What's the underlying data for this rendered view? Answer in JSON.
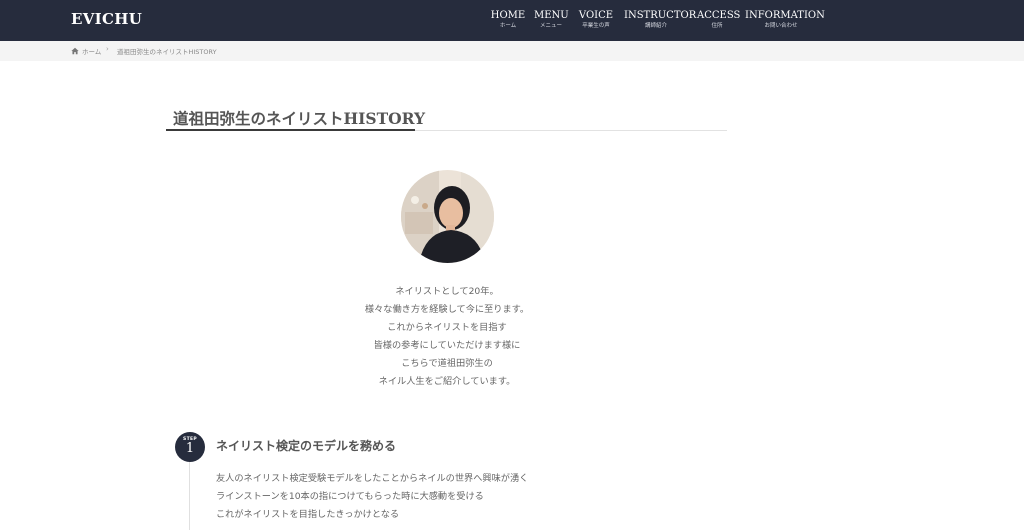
{
  "header": {
    "logo": "EVICHU",
    "nav": [
      {
        "label": "HOME",
        "sub": "ホーム"
      },
      {
        "label": "MENU",
        "sub": "メニュー"
      },
      {
        "label": "VOICE",
        "sub": "卒業生の声"
      },
      {
        "label": "INSTRUCTOR",
        "sub": "講師紹介"
      },
      {
        "label": "ACCESS",
        "sub": "住所"
      },
      {
        "label": "INFORMATION",
        "sub": "お問い合わせ"
      }
    ],
    "colors": {
      "background": "#262c3d",
      "text": "#ffffff"
    }
  },
  "breadcrumb": {
    "home_icon": "home-icon",
    "home": "ホーム",
    "separator": "›",
    "current": "道祖田弥生のネイリストHISTORY"
  },
  "page": {
    "title": "道祖田弥生のネイリストHISTORY",
    "intro_lines": [
      "ネイリストとして20年。",
      "様々な働き方を経験して今に至ります。",
      "これからネイリストを目指す",
      "皆様の参考にしていただけます様に",
      "こちらで道祖田弥生の",
      "ネイル人生をご紹介しています。"
    ]
  },
  "steps": [
    {
      "label": "STEP",
      "number": "1",
      "title": "ネイリスト検定のモデルを務める",
      "lines": [
        "友人のネイリスト検定受験モデルをしたことからネイルの世界へ興味が湧く",
        "ラインストーンを10本の指につけてもらった時に大感動を受ける",
        "これがネイリストを目指したきっかけとなる"
      ]
    }
  ]
}
